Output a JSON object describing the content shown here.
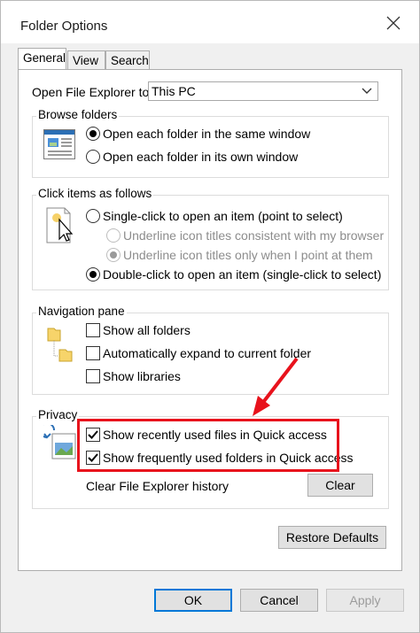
{
  "window": {
    "title": "Folder Options"
  },
  "tabs": [
    {
      "label": "General"
    },
    {
      "label": "View"
    },
    {
      "label": "Search"
    }
  ],
  "open_explorer": {
    "label": "Open File Explorer to:",
    "value": "This PC"
  },
  "browse_folders": {
    "title": "Browse folders",
    "options": [
      {
        "label": "Open each folder in the same window",
        "checked": true
      },
      {
        "label": "Open each folder in its own window",
        "checked": false
      }
    ]
  },
  "click_items": {
    "title": "Click items as follows",
    "single_click": "Single-click to open an item (point to select)",
    "sub_options": [
      "Underline icon titles consistent with my browser",
      "Underline icon titles only when I point at them"
    ],
    "double_click": "Double-click to open an item (single-click to select)"
  },
  "navigation_pane": {
    "title": "Navigation pane",
    "options": [
      {
        "label": "Show all folders",
        "checked": false
      },
      {
        "label": "Automatically expand to current folder",
        "checked": false
      },
      {
        "label": "Show libraries",
        "checked": false
      }
    ]
  },
  "privacy": {
    "title": "Privacy",
    "options": [
      {
        "label": "Show recently used files in Quick access",
        "checked": true
      },
      {
        "label": "Show frequently used folders in Quick access",
        "checked": true
      }
    ],
    "clear_label": "Clear File Explorer history",
    "clear_button": "Clear"
  },
  "restore_defaults": "Restore Defaults",
  "footer": {
    "ok": "OK",
    "cancel": "Cancel",
    "apply": "Apply"
  },
  "annotation": {
    "color": "#e8121c"
  }
}
